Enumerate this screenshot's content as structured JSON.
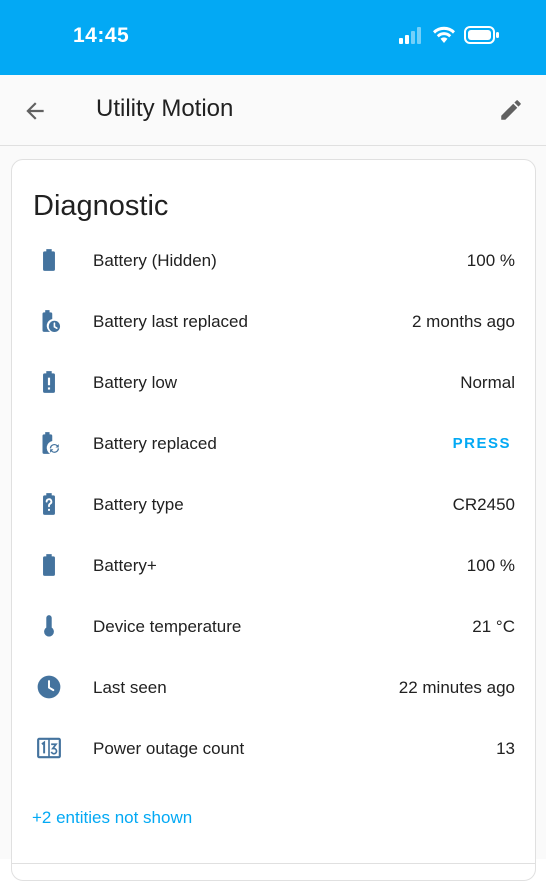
{
  "status_bar": {
    "time": "14:45"
  },
  "header": {
    "title": "Utility Motion"
  },
  "card": {
    "title": "Diagnostic",
    "rows": [
      {
        "label": "Battery (Hidden)",
        "value": "100 %",
        "icon": "battery-icon"
      },
      {
        "label": "Battery last replaced",
        "value": "2 months ago",
        "icon": "battery-clock-icon"
      },
      {
        "label": "Battery low",
        "value": "Normal",
        "icon": "battery-alert-icon"
      },
      {
        "label": "Battery replaced",
        "value": "PRESS",
        "icon": "battery-sync-icon"
      },
      {
        "label": "Battery type",
        "value": "CR2450",
        "icon": "battery-unknown-icon"
      },
      {
        "label": "Battery+",
        "value": "100 %",
        "icon": "battery-icon"
      },
      {
        "label": "Device temperature",
        "value": "21 °C",
        "icon": "thermometer-icon"
      },
      {
        "label": "Last seen",
        "value": "22 minutes ago",
        "icon": "clock-icon"
      },
      {
        "label": "Power outage count",
        "value": "13",
        "icon": "counter-icon"
      }
    ],
    "more_link": "+2 entities not shown"
  },
  "colors": {
    "accent": "#03a9f4",
    "icon": "#44739e",
    "text": "#212121"
  }
}
